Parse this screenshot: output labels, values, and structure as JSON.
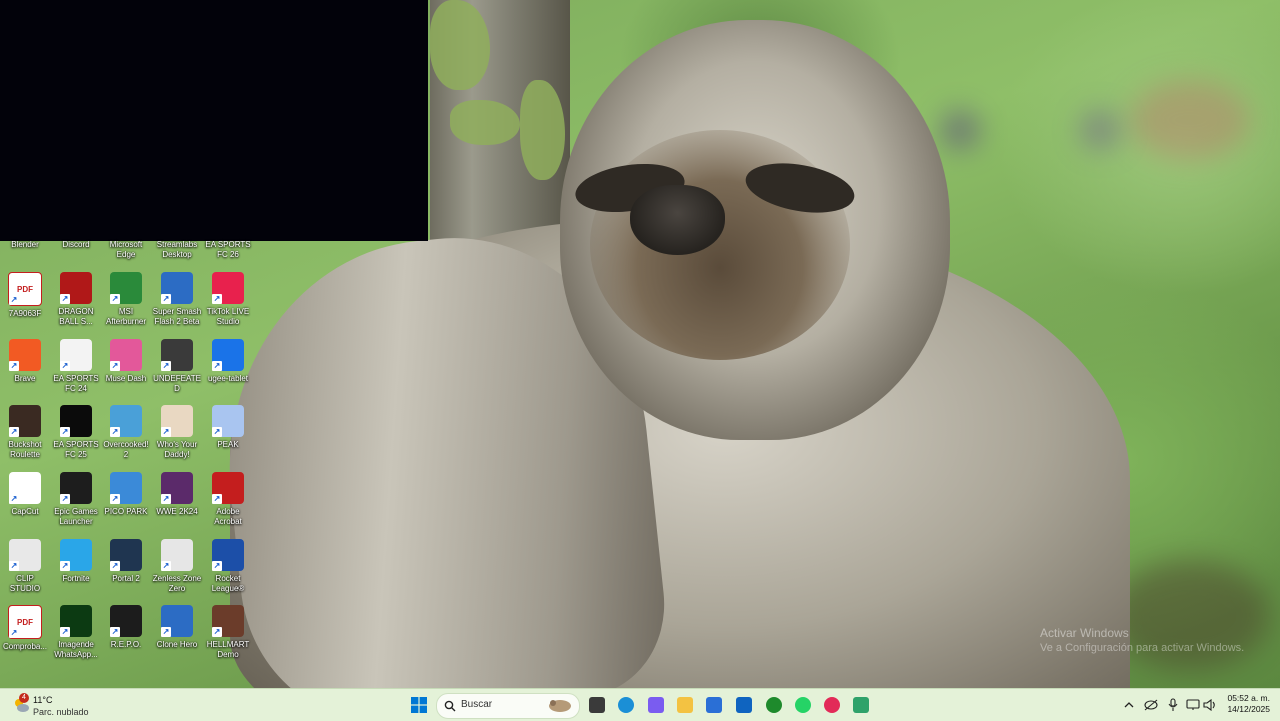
{
  "desktop": {
    "partial_row_labels": [
      "Blender",
      "Discord",
      "Microsoft Edge",
      "Streamlabs Desktop",
      "EA SPORTS FC 26"
    ],
    "icons": [
      {
        "label": "7A9063F",
        "icon": "pdf-icon",
        "color": "#ffffff"
      },
      {
        "label": "DRAGON BALL S...",
        "icon": "dragon-ball-icon",
        "color": "#b01818"
      },
      {
        "label": "MSI Afterburner",
        "icon": "msi-afterburner-icon",
        "color": "#2a8a3a"
      },
      {
        "label": "Super Smash Flash 2 Beta",
        "icon": "smash-flash-icon",
        "color": "#2c6cc4"
      },
      {
        "label": "TikTok LIVE Studio",
        "icon": "tiktok-icon",
        "color": "#e8214d"
      },
      {
        "label": "Brave",
        "icon": "brave-icon",
        "color": "#f25a23"
      },
      {
        "label": "EA SPORTS FC 24",
        "icon": "fc24-icon",
        "color": "#f3f3f3"
      },
      {
        "label": "Muse Dash",
        "icon": "muse-dash-icon",
        "color": "#e3589a"
      },
      {
        "label": "UNDEFEATED",
        "icon": "undefeated-icon",
        "color": "#3a3a3a"
      },
      {
        "label": "ugee-tablet",
        "icon": "ugee-icon",
        "color": "#1a73e8"
      },
      {
        "label": "Buckshot Roulette",
        "icon": "buckshot-icon",
        "color": "#3a2a22"
      },
      {
        "label": "EA SPORTS FC 25",
        "icon": "fc25-icon",
        "color": "#0b0b0b"
      },
      {
        "label": "Overcooked! 2",
        "icon": "overcooked-icon",
        "color": "#4aa0d8"
      },
      {
        "label": "Who's Your Daddy!",
        "icon": "whos-your-daddy-icon",
        "color": "#e9d8c2"
      },
      {
        "label": "PEAK",
        "icon": "peak-icon",
        "color": "#a9c5f0"
      },
      {
        "label": "CapCut",
        "icon": "capcut-icon",
        "color": "#ffffff"
      },
      {
        "label": "Epic Games Launcher",
        "icon": "epic-games-icon",
        "color": "#1d1d1d"
      },
      {
        "label": "PICO PARK",
        "icon": "pico-park-icon",
        "color": "#3b8ad8"
      },
      {
        "label": "WWE 2K24",
        "icon": "wwe-icon",
        "color": "#5b2a6a"
      },
      {
        "label": "Adobe Acrobat",
        "icon": "acrobat-icon",
        "color": "#c41e1e"
      },
      {
        "label": "CLIP STUDIO",
        "icon": "clip-studio-icon",
        "color": "#e8e8e8"
      },
      {
        "label": "Fortnite",
        "icon": "fortnite-icon",
        "color": "#2aa6e8"
      },
      {
        "label": "Portal 2",
        "icon": "portal2-icon",
        "color": "#1f3550"
      },
      {
        "label": "Zenless Zone Zero",
        "icon": "zenless-icon",
        "color": "#e6e6e6"
      },
      {
        "label": "Rocket League®",
        "icon": "rocket-league-icon",
        "color": "#1c4fa8"
      },
      {
        "label": "Comproba...",
        "icon": "pdf-icon",
        "color": "#ffffff"
      },
      {
        "label": "Imagende WhatsApp...",
        "icon": "whatsapp-image-icon",
        "color": "#0c3a12"
      },
      {
        "label": "R.E.P.O.",
        "icon": "repo-icon",
        "color": "#1c1c1c"
      },
      {
        "label": "Clone Hero",
        "icon": "clone-hero-icon",
        "color": "#2c6cc4"
      },
      {
        "label": "HELLMART Demo",
        "icon": "hellmart-icon",
        "color": "#6b3c2a"
      }
    ]
  },
  "wallpaper": {
    "watermark_title": "Activar Windows",
    "watermark_sub": "Ve a Configuración para activar Windows."
  },
  "taskbar": {
    "weather": {
      "temp": "11°C",
      "desc": "Parc. nublado",
      "badge": "4"
    },
    "search_placeholder": "Buscar",
    "pinned": [
      {
        "icon": "file-explorer-icon"
      },
      {
        "icon": "edge-icon"
      },
      {
        "icon": "copilot-icon"
      },
      {
        "icon": "folder-icon"
      },
      {
        "icon": "store-icon"
      },
      {
        "icon": "outlook-icon"
      },
      {
        "icon": "xbox-icon"
      },
      {
        "icon": "whatsapp-icon"
      },
      {
        "icon": "media-player-icon"
      },
      {
        "icon": "android-app-icon"
      }
    ],
    "clock": {
      "time": "05:52 a. m.",
      "date": "14/12/2025"
    }
  },
  "colors": {
    "taskbar_bg": "#e4f2d8",
    "windows_blue": "#0078d4"
  }
}
